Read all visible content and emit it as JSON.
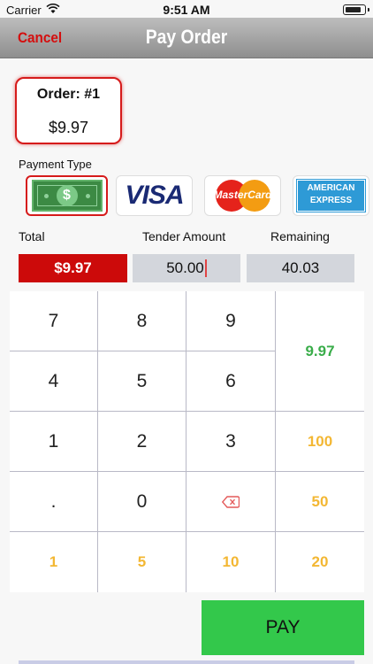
{
  "status": {
    "carrier": "Carrier",
    "time": "9:51 AM"
  },
  "nav": {
    "cancel": "Cancel",
    "title": "Pay Order"
  },
  "order": {
    "number": "Order: #1",
    "total": "$9.97"
  },
  "payment": {
    "label": "Payment Type",
    "methods": [
      "cash-icon",
      "visa-icon",
      "mastercard-icon",
      "amex-icon"
    ],
    "visa_text": "VISA",
    "mastercard_text": "MasterCard",
    "amex_line1": "AMERICAN",
    "amex_line2": "EXPRESS",
    "selected": "cash"
  },
  "amounts": {
    "total_label": "Total",
    "tender_label": "Tender Amount",
    "remaining_label": "Remaining",
    "total_value": "$9.97",
    "tender_value": "50.00",
    "remaining_value": "40.03"
  },
  "keypad": {
    "k7": "7",
    "k8": "8",
    "k9": "9",
    "k4": "4",
    "k5": "5",
    "k6": "6",
    "k1": "1",
    "k2": "2",
    "k3": "3",
    "kdot": ".",
    "k0": "0",
    "exact": "9.97",
    "q100": "100",
    "q50": "50",
    "q20": "20",
    "q1": "1",
    "q5": "5",
    "q10": "10"
  },
  "pay_label": "PAY",
  "colors": {
    "accent_red": "#cc0a0a",
    "pay_green": "#33c84b",
    "quick_yellow": "#f3b733",
    "exact_green": "#3aad4a"
  }
}
